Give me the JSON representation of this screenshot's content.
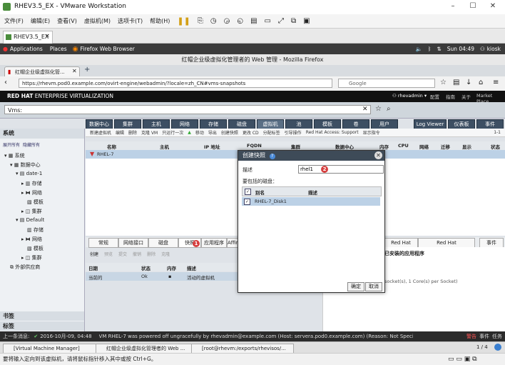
{
  "vmware": {
    "title": "RHEV3.5_EX - VMware Workstation",
    "menu": [
      "文件(F)",
      "编辑(E)",
      "查看(V)",
      "虚拟机(M)",
      "选项卡(T)",
      "帮助(H)"
    ],
    "tab": "RHEV3.5_EX"
  },
  "gnome": {
    "applications": "Applications",
    "places": "Places",
    "ff_launcher": "Firefox Web Browser",
    "clock": "Sun 04:49",
    "user": "kiosk"
  },
  "firefox": {
    "window_title": "红帽企业级虚拟化管理者的 Web 管理 - Mozilla Firefox",
    "tab_label": "红帽企业级虚拟化管...",
    "url": "https://rhevm.pod0.example.com/ovirt-engine/webadmin/?locale=zh_CN#vms-snapshots",
    "search_placeholder": "Google"
  },
  "rhev": {
    "brand_bold": "RED HAT",
    "brand_rest": " ENTERPRISE VIRTUALIZATION",
    "user": "rhevadmin",
    "header_links": [
      "配置",
      "指南",
      "关于",
      "Market Place"
    ],
    "search_value": "Vms:",
    "sidebar_title": "系统",
    "sidebar_links": [
      "展开所有",
      "隐藏所有"
    ],
    "tree": [
      "系统",
      "数据中心",
      "date-1",
      "存储",
      "网络",
      "模板",
      "集群",
      "Default",
      "存储",
      "网络",
      "模板",
      "集群",
      "外部供应商"
    ],
    "sidebar_bottom": [
      "书签",
      "标签"
    ],
    "main_tabs": [
      "数据中心",
      "集群",
      "主机",
      "网络",
      "存储",
      "磁盘",
      "虚拟机",
      "池",
      "模板",
      "卷",
      "用户",
      "Log Viewer",
      "仪表板",
      "事件"
    ],
    "toolbar": [
      "新建虚拟机",
      "编辑",
      "删除",
      "克隆 VM",
      "只运行一次",
      "移动",
      "导出",
      "创建快照",
      "更改 CD",
      "分配标签",
      "引导操作",
      "Red Hat Access: Support",
      "显示指令"
    ],
    "pagination": "1-1",
    "grid_cols": [
      "名称",
      "主机",
      "IP 地址",
      "FQDN",
      "集群",
      "数据中心",
      "内存",
      "CPU",
      "网络",
      "迁移",
      "显示",
      "状态"
    ],
    "grid_row_name": "RHEL-7",
    "sub_tabs": [
      "常规",
      "网络接口",
      "磁盘",
      "快照",
      "应用程序",
      "Affinity",
      "Red Hat Search",
      "Red Hat Documentation",
      "事件"
    ],
    "sub_toolbar": [
      "创建",
      "预览",
      "提交",
      "撤销",
      "删除",
      "克隆"
    ],
    "snap_cols": [
      "日期",
      "状态",
      "内存",
      "描述"
    ],
    "snap_row": {
      "date": "当前的",
      "status": "Ok",
      "desc": "活动的虚拟机"
    },
    "right_title": "已安装的应用程序",
    "right_text": "socket(s), 1 Core(s) per Socket)",
    "status_label": "上一条消息:",
    "status_time": "2016-10月-09, 04:48",
    "status_msg": "VM RHEL-7 was powered off ungracefully by rhevadmin@example.com (Host: servera.pod0.example.com) (Reason: Not Specified)",
    "status_alert": "警告",
    "status_events": "事件",
    "status_tasks": "任务"
  },
  "dialog": {
    "title": "创建快照",
    "desc_label": "描述",
    "desc_value": "rhel1",
    "disks_label": "要包括的磁盘：",
    "disk_cols": [
      "别名",
      "描述"
    ],
    "disk_row": "RHEL-7_Disk1",
    "ok": "确定",
    "cancel": "取消",
    "badge1": "1",
    "badge2": "2"
  },
  "taskbar": {
    "items": [
      "[Virtual Machine Manager]",
      "红帽企业级虚拟化管理者的 Web ...",
      "[root@rhevm:/exports/rhevisos/..."
    ],
    "pager": "1 / 4"
  },
  "bottom_hint": "要将输入定向到该虚拟机，请将鼠标指针移入其中或按 Ctrl+G。",
  "colors": {
    "accent": "#3d4f63",
    "selection": "#bcd1e6",
    "brand": "#cc0000"
  }
}
